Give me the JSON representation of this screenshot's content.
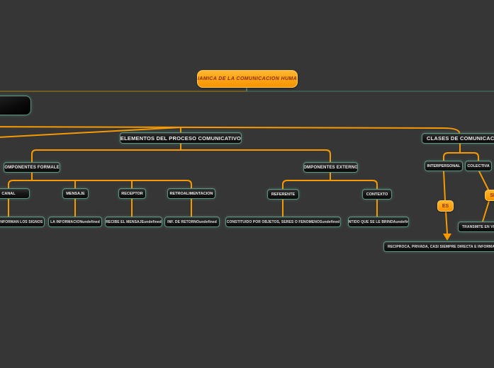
{
  "colors": {
    "background": "#363636",
    "accent_orange": "#f79a00",
    "node_border_teal": "#5a9884",
    "root_text": "#8a2d00",
    "rule_left_olive": "#6f5b26",
    "rule_right_teal": "#3d584c"
  },
  "root": {
    "label": "DINAMICA  DE LA COMUNICACION HUMANA"
  },
  "branches": {
    "elementos": {
      "label": "ELEMENTOS DEL PROCESO COMUNICATIVO",
      "formales": {
        "label": "COMPONENTES FORMALES",
        "children": [
          {
            "label": "CANAL",
            "desc": "CONFORMAN LOS SIGNOS"
          },
          {
            "label": "MENSAJE",
            "desc": "LA INFORMACIONundefined"
          },
          {
            "label": "RECEPTOR",
            "desc": "RECIBE EL MENSAJEundefined"
          },
          {
            "label": "RETROALIMENTACION",
            "desc": "INF. DE RETORNOundefined"
          }
        ]
      },
      "externos": {
        "label": "COMPONENTES EXTERNOS",
        "children": [
          {
            "label": "REFERENTE",
            "desc": "CONSTITUIDO POR OBJETOS, SERES O FENOMENOSundefined"
          },
          {
            "label": "CONTEXTO",
            "desc": "SENTIDO QUE SE LE BRINDAundefined"
          }
        ]
      }
    },
    "clases": {
      "label": "CLASES DE COMUNICACIÓN",
      "children": [
        {
          "label": "INTERPERSONAL",
          "connector": "ES",
          "desc": "RECIPROCA, PRIVADA, CASI SIEMPRE DIRECTA E INFORMAL"
        },
        {
          "label": "COLECTIVA",
          "connector": "SE",
          "desc": "TRANSMITE EN VI"
        }
      ]
    }
  }
}
